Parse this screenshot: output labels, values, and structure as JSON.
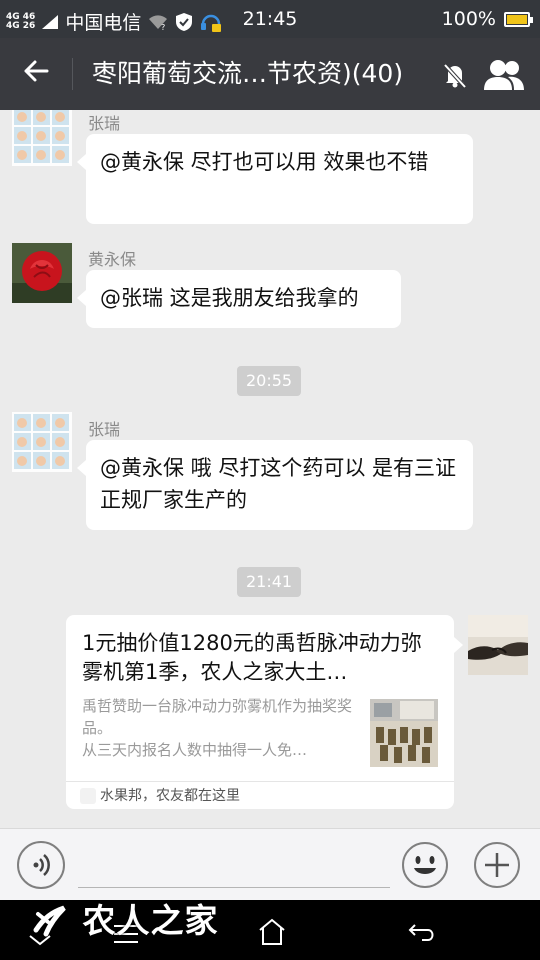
{
  "status": {
    "network": [
      "4G",
      "4G"
    ],
    "signal": [
      "46",
      "26"
    ],
    "carrier": "中国电信",
    "time": "21:45",
    "battery": "100%",
    "battery_level": 1.0
  },
  "header": {
    "title": "枣阳葡萄交流…节农资)(40)",
    "back_icon": "back-arrow-icon",
    "mute_icon": "mute-bell-icon",
    "members_icon": "group-members-icon"
  },
  "messages": [
    {
      "sender": "张瑞",
      "text": "@黄永保 尽打也可以用  效果也不错",
      "avatar_icon": "baby-photo-grid-avatar"
    },
    {
      "sender": "黄永保",
      "text": "@张瑞 这是我朋友给我拿的",
      "avatar_icon": "red-rose-avatar"
    },
    {
      "time": "20:55"
    },
    {
      "sender": "张瑞",
      "text": "@黄永保 哦  尽打这个药可以   是有三证正规厂家生产的",
      "avatar_icon": "baby-photo-grid-avatar"
    },
    {
      "time": "21:41"
    }
  ],
  "share_card": {
    "title": "1元抽价值1280元的禹哲脉冲动力弥雾机第1季，农人之家大土…",
    "desc_line1": "禹哲赞助一台脉冲动力弥雾机作为抽奖奖品。",
    "desc_line2": "从三天内报名人数中抽得一人免…",
    "source": "水果邦，农友都在这里",
    "self_avatar_icon": "handshake-avatar",
    "thumb_icon": "sprayer-machines-thumbnail"
  },
  "input": {
    "placeholder": "",
    "voice_icon": "voice-icon",
    "emoji_icon": "emoji-icon",
    "plus_icon": "plus-icon"
  },
  "watermark": "农人之家",
  "colors": {
    "titlebar": "#393a3f",
    "statusbar": "#34373c",
    "chat_bg": "#ebebeb",
    "bubble": "#ffffff",
    "time_pill": "#cecece"
  }
}
